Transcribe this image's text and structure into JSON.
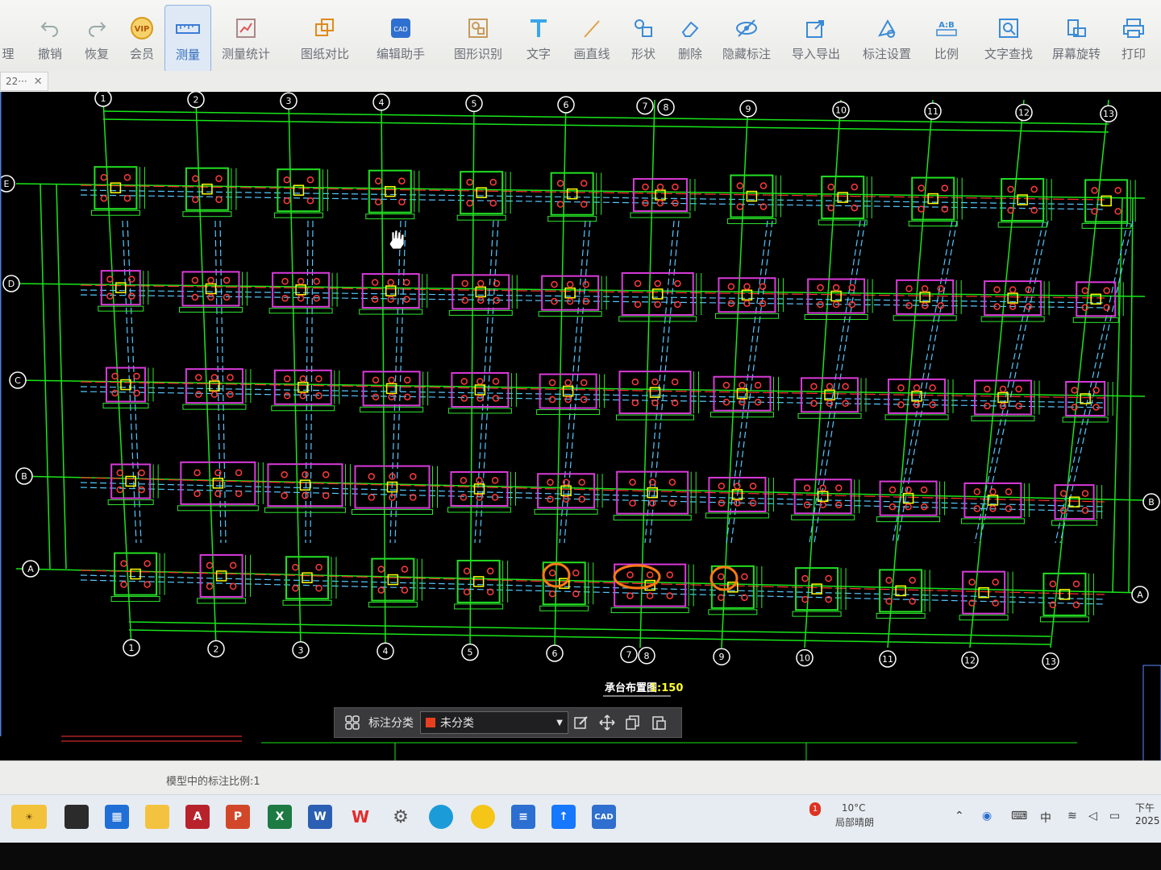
{
  "toolbar": {
    "items": [
      {
        "label": "理",
        "icon": "app-menu-icon"
      },
      {
        "label": "撤销",
        "icon": "undo-icon"
      },
      {
        "label": "恢复",
        "icon": "redo-icon"
      },
      {
        "label": "会员",
        "icon": "vip-icon",
        "icon_text": "VIP"
      },
      {
        "label": "测量",
        "icon": "measure-icon",
        "active": true
      },
      {
        "label": "测量统计",
        "icon": "measure-stats-icon"
      },
      {
        "label": "图纸对比",
        "icon": "compare-icon"
      },
      {
        "label": "编辑助手",
        "icon": "edit-assistant-icon"
      },
      {
        "label": "图形识别",
        "icon": "shape-recognition-icon"
      },
      {
        "label": "文字",
        "icon": "text-icon"
      },
      {
        "label": "画直线",
        "icon": "line-icon"
      },
      {
        "label": "形状",
        "icon": "shape-icon"
      },
      {
        "label": "删除",
        "icon": "eraser-icon"
      },
      {
        "label": "隐藏标注",
        "icon": "hide-annotation-icon"
      },
      {
        "label": "导入导出",
        "icon": "import-export-icon"
      },
      {
        "label": "标注设置",
        "icon": "annotation-settings-icon"
      },
      {
        "label": "比例",
        "icon": "scale-icon",
        "icon_text": "A:B"
      },
      {
        "label": "文字查找",
        "icon": "text-search-icon"
      },
      {
        "label": "屏幕旋转",
        "icon": "screen-rotate-icon"
      },
      {
        "label": "打印",
        "icon": "print-icon"
      }
    ]
  },
  "tabs": {
    "doc_tab_label": "22···",
    "close_glyph": "✕"
  },
  "drawing": {
    "column_axis_labels": [
      "1",
      "2",
      "3",
      "4",
      "5",
      "6",
      "7",
      "8",
      "9",
      "10",
      "11",
      "12",
      "13"
    ],
    "row_axis_labels": [
      "E",
      "D",
      "C",
      "B",
      "A"
    ],
    "title": "承台布置图",
    "scale": "1:150",
    "colors": {
      "grid": "#19e619",
      "dim": "#30e830",
      "cap_green": "#22e022",
      "cap_magenta": "#d93ad9",
      "pile": "#ff3b3b",
      "beam": "#55c8ff",
      "axis_line": "#ff3030",
      "markup": "#ff7a12",
      "column": "#ffff00"
    }
  },
  "annotation_toolbar": {
    "category_label": "标注分类",
    "selected_category": "未分类",
    "swatch_color": "#e8401e"
  },
  "status": {
    "text": "模型中的标注比例:1"
  },
  "taskbar": {
    "weather_temp": "10°C",
    "weather_desc": "局部晴朗",
    "weather_badge": "1",
    "ime": "中",
    "clock_top": "下午",
    "clock_bottom": "2025"
  }
}
